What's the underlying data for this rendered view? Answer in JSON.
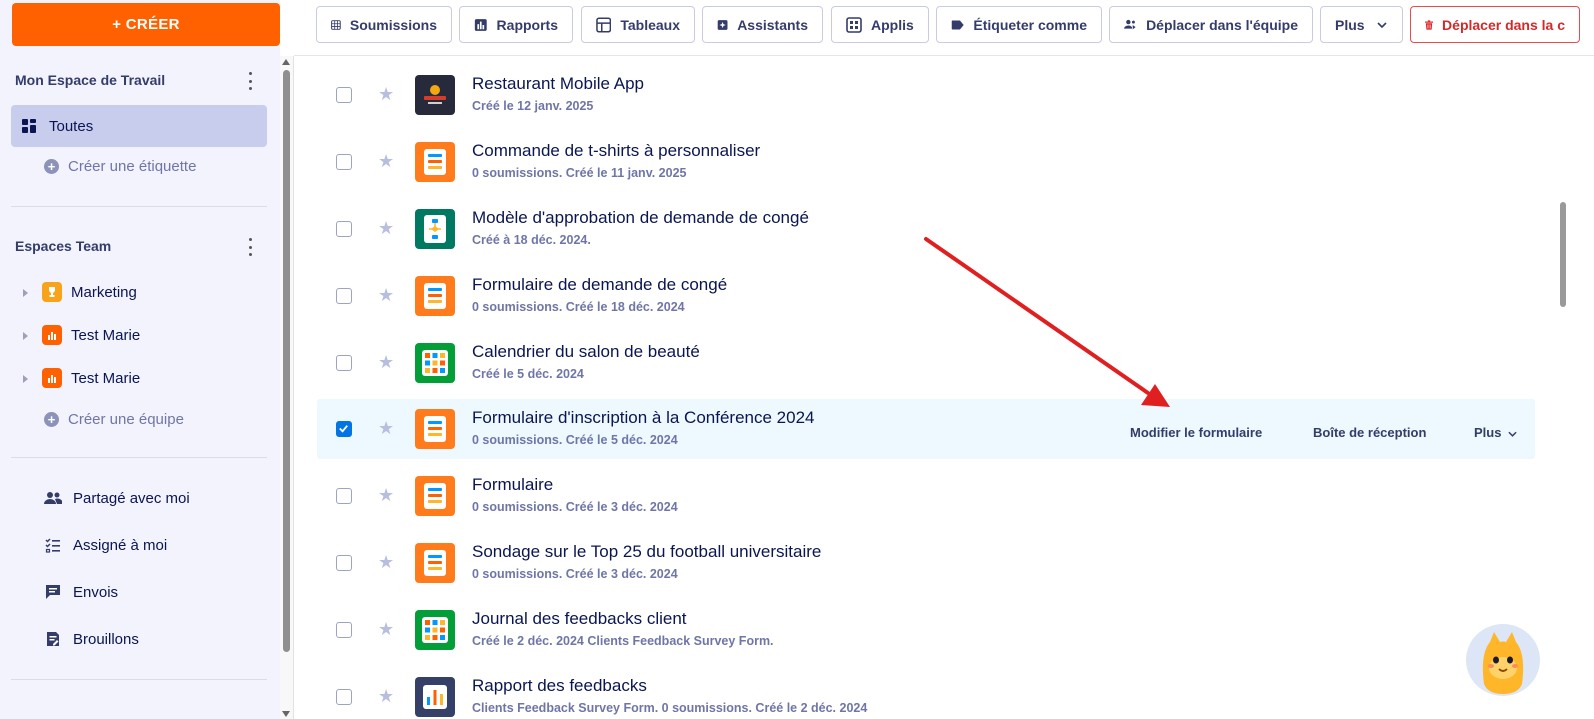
{
  "sidebar": {
    "create_label": "+ CRÉER",
    "workspace_title": "Mon Espace de Travail",
    "all_label": "Toutes",
    "create_tag_label": "Créer une étiquette",
    "team_spaces_title": "Espaces Team",
    "teams": [
      {
        "label": "Marketing",
        "color": "#f9a31a"
      },
      {
        "label": "Test Marie",
        "color": "#ff6100"
      },
      {
        "label": "Test Marie",
        "color": "#ff6100"
      }
    ],
    "create_team_label": "Créer une équipe",
    "shared_label": "Partagé avec moi",
    "assigned_label": "Assigné à moi",
    "sent_label": "Envois",
    "drafts_label": "Brouillons"
  },
  "toolbar": {
    "submissions": "Soumissions",
    "reports": "Rapports",
    "tables": "Tableaux",
    "assistants": "Assistants",
    "apps": "Applis",
    "tag_as": "Étiqueter comme",
    "move_team": "Déplacer dans l'équipe",
    "more": "Plus",
    "move_trash": "Déplacer dans la c"
  },
  "forms": [
    {
      "title": "Restaurant Mobile App",
      "subtitle": "Créé le 12 janv. 2025",
      "icon": "app-icon",
      "checked": false
    },
    {
      "title": "Commande de t-shirts à personnaliser",
      "subtitle": "0 soumissions. Créé le 11 janv. 2025",
      "icon": "form-icon",
      "checked": false
    },
    {
      "title": "Modèle d'approbation de demande de congé",
      "subtitle": "Créé à 18 déc. 2024.",
      "icon": "workflow-icon",
      "checked": false
    },
    {
      "title": "Formulaire de demande de congé",
      "subtitle": "0 soumissions. Créé le 18 déc. 2024",
      "icon": "form-icon",
      "checked": false
    },
    {
      "title": "Calendrier du salon de beauté",
      "subtitle": "Créé le 5 déc. 2024",
      "icon": "table-icon",
      "checked": false
    },
    {
      "title": "Formulaire d'inscription à la Conférence 2024",
      "subtitle": "0 soumissions. Créé le 5 déc. 2024",
      "icon": "form-icon",
      "checked": true
    },
    {
      "title": "Formulaire",
      "subtitle": "0 soumissions. Créé le 3 déc. 2024",
      "icon": "form-icon",
      "checked": false
    },
    {
      "title": "Sondage sur le Top 25 du football universitaire",
      "subtitle": "0 soumissions. Créé le 3 déc. 2024",
      "icon": "form-icon",
      "checked": false
    },
    {
      "title": "Journal des feedbacks client",
      "subtitle": "Créé le 2 déc. 2024 Clients Feedback Survey Form.",
      "icon": "table-icon",
      "checked": false
    },
    {
      "title": "Rapport des feedbacks",
      "subtitle": "Clients Feedback Survey Form. 0 soumissions. Créé le 2 déc. 2024",
      "icon": "report-icon",
      "checked": false
    }
  ],
  "row_actions": {
    "edit": "Modifier le formulaire",
    "inbox": "Boîte de réception",
    "more": "Plus"
  },
  "colors": {
    "accent": "#ff6100",
    "form_orange": "#ff7b1c",
    "table_green": "#049e38",
    "workflow_teal": "#007862",
    "report_navy": "#344067",
    "annotation_red": "#e02020"
  }
}
